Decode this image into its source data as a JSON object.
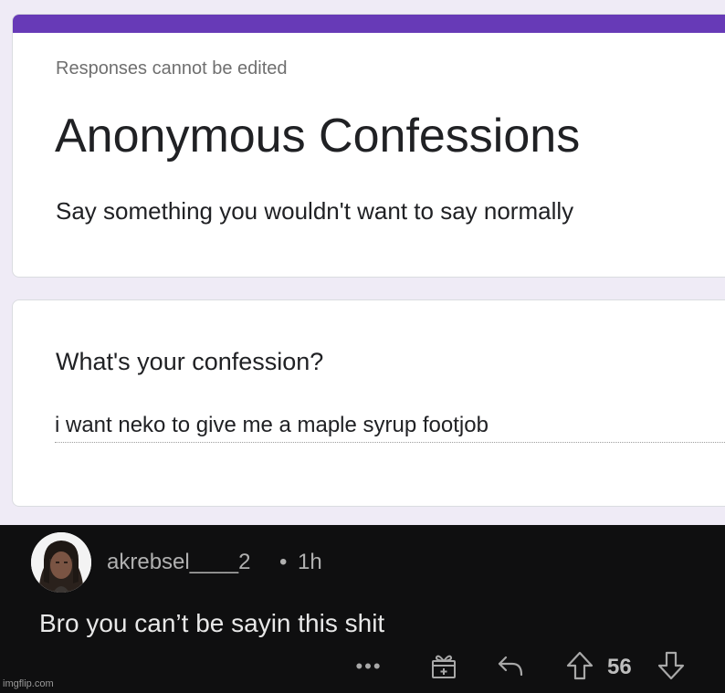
{
  "form": {
    "notice": "Responses cannot be edited",
    "title": "Anonymous Confessions",
    "description": "Say something you wouldn't want to say normally",
    "accent_color": "#673ab7",
    "question": {
      "label": "What's your confession?",
      "answer": "i want neko to give me a maple syrup footjob"
    }
  },
  "comment": {
    "username": "akrebsel____2",
    "separator": "•",
    "time": "1h",
    "text": "Bro you can’t be sayin this shit",
    "more_label": "•••",
    "score": "56",
    "icons": [
      "more-icon",
      "award-icon",
      "reply-icon",
      "upvote-icon",
      "downvote-icon"
    ]
  },
  "watermark": "imgflip.com"
}
